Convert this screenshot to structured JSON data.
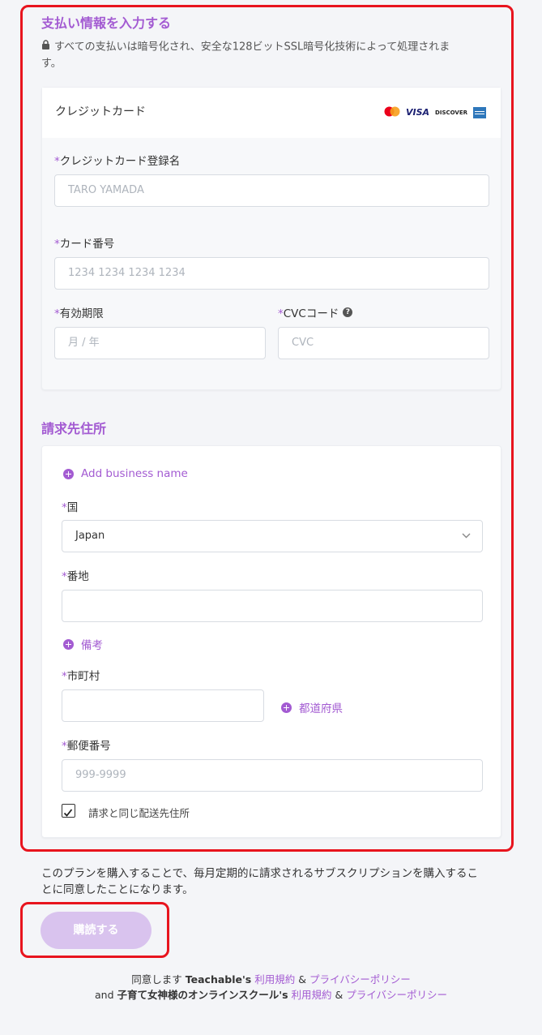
{
  "payment": {
    "title": "支払い情報を入力する",
    "security_note_line1": "すべての支払いは暗号化され、安全な128ビットSSL暗号化技術によって処理されま",
    "security_note_line2": "す。",
    "method_label": "クレジットカード",
    "card_brands": [
      "mastercard",
      "VISA",
      "DISCOVER",
      "amex"
    ],
    "name_label": "クレジットカード登録名",
    "name_placeholder": "TARO YAMADA",
    "number_label": "カード番号",
    "number_placeholder": "1234 1234 1234 1234",
    "expiry_label": "有効期限",
    "expiry_placeholder": "月 / 年",
    "cvc_label": "CVCコード",
    "cvc_placeholder": "CVC"
  },
  "billing": {
    "title": "請求先住所",
    "add_business": "Add business name",
    "country_label": "国",
    "country_value": "Japan",
    "street_label": "番地",
    "street_value": "",
    "memo_link": "備考",
    "city_label": "市町村",
    "city_value": "",
    "prefecture_link": "都道府県",
    "postal_label": "郵便番号",
    "postal_placeholder": "999-9999",
    "same_shipping_label": "請求と同じ配送先住所",
    "same_shipping_checked": true
  },
  "subscription_note_line1": "このプランを購入することで、毎月定期的に請求されるサブスクリプションを購入するこ",
  "subscription_note_line2": "とに同意したことになります。",
  "purchase_button": "購読する",
  "footer": {
    "line1_prefix": "同意します",
    "line1_brand": "Teachable's",
    "terms": "利用規約",
    "amp": "&",
    "privacy": "プライバシーポリシー",
    "line2_and": "and",
    "line2_brand": "子育て女神様のオンラインスクール's"
  },
  "colors": {
    "accent": "#a35bd2",
    "highlight_frame": "#e8141e",
    "button_disabled": "#d9c3ee"
  }
}
